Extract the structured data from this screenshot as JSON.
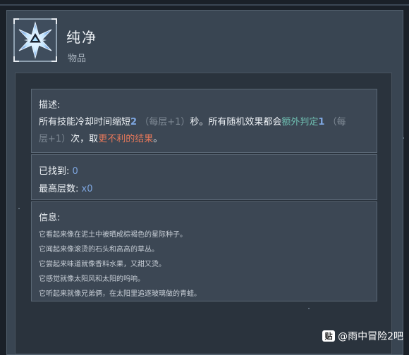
{
  "item": {
    "name": "纯净",
    "category": "物品",
    "icon": "crystal-star-icon"
  },
  "description": {
    "heading": "描述:",
    "line1_a": "所有技能冷却时间缩短",
    "line1_num": "2",
    "line1_stack": "（每层+1）",
    "line1_b": "秒。所有随机效果都会",
    "line1_special": "额外判定",
    "line1_num2": "1",
    "line1_stack2": "（每",
    "line2_stack": "层+1）",
    "line2_a": "次，取",
    "line2_bad": "更不利的结果",
    "line2_end": "。"
  },
  "stats": {
    "found_label": "已找到:",
    "found_value": "0",
    "max_stack_label": "最高层数:",
    "max_stack_value": "x0"
  },
  "info": {
    "heading": "信息:",
    "lines": [
      "它看起来像在泥土中被晒成棕褐色的星际种子。",
      "它闻起来像滚烫的石头和高高的草丛。",
      "它尝起来味道就像香料水果，又甜又烫。",
      "它感觉就像太阳风和太阳的呜响。",
      "它听起来就像兄弟俩，在太阳里追逐玻璃做的青蛙。"
    ]
  },
  "watermark": {
    "badge": "贴",
    "text": "@雨中冒险2吧"
  },
  "colors": {
    "number": "#7ea6e0",
    "stack": "#7f8a95",
    "special": "#6fbfb2",
    "bad": "#e8785a"
  }
}
